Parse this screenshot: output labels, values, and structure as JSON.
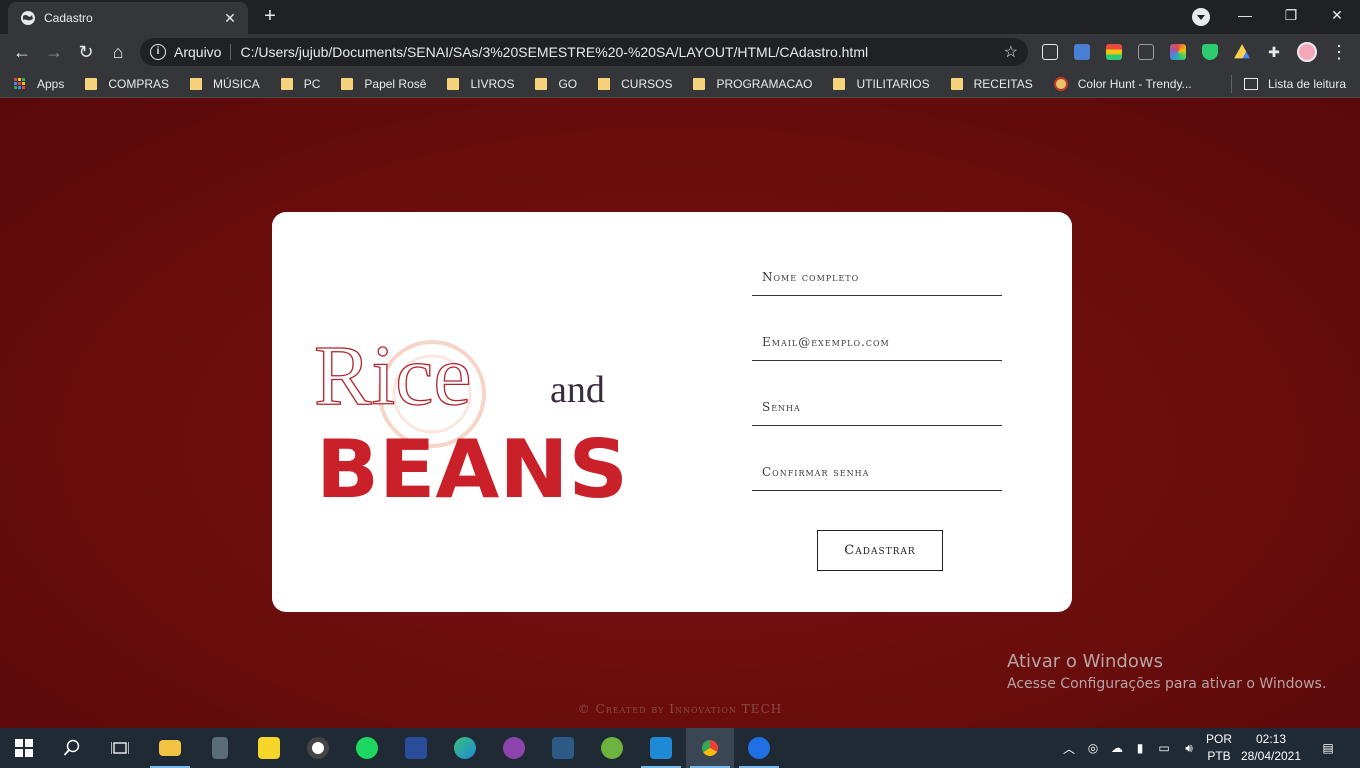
{
  "browser": {
    "tab_title": "Cadastro",
    "url_scheme": "Arquivo",
    "url": "C:/Users/jujub/Documents/SENAI/SAs/3%20SEMESTRE%20-%20SA/LAYOUT/HTML/CAdastro.html"
  },
  "bookmarks": {
    "items": [
      "Apps",
      "COMPRAS",
      "MÚSICA",
      "PC",
      "Papel Rosê",
      "LIVROS",
      "GO",
      "CURSOS",
      "PROGRAMACAO",
      "UTILITARIOS",
      "RECEITAS",
      "Color Hunt - Trendy..."
    ],
    "reading_list": "Lista de leitura"
  },
  "page": {
    "logo": {
      "word1": "Rice",
      "word2": "and",
      "word3": "BEANS"
    },
    "form": {
      "name_placeholder": "Nome completo",
      "email_placeholder": "Email@exemplo.com",
      "password_placeholder": "Senha",
      "confirm_placeholder": "Confirmar senha",
      "submit_label": "Cadastrar"
    },
    "footer": "© Created by Innovation TECH"
  },
  "watermark": {
    "line1": "Ativar o Windows",
    "line2": "Acesse Configurações para ativar o Windows."
  },
  "taskbar": {
    "language": "POR",
    "layout": "PTB",
    "time": "02:13",
    "date": "28/04/2021"
  },
  "colors": {
    "background": "#6b0d0d",
    "logo_red": "#c9202a",
    "logo_dark": "#3a2b3f"
  }
}
